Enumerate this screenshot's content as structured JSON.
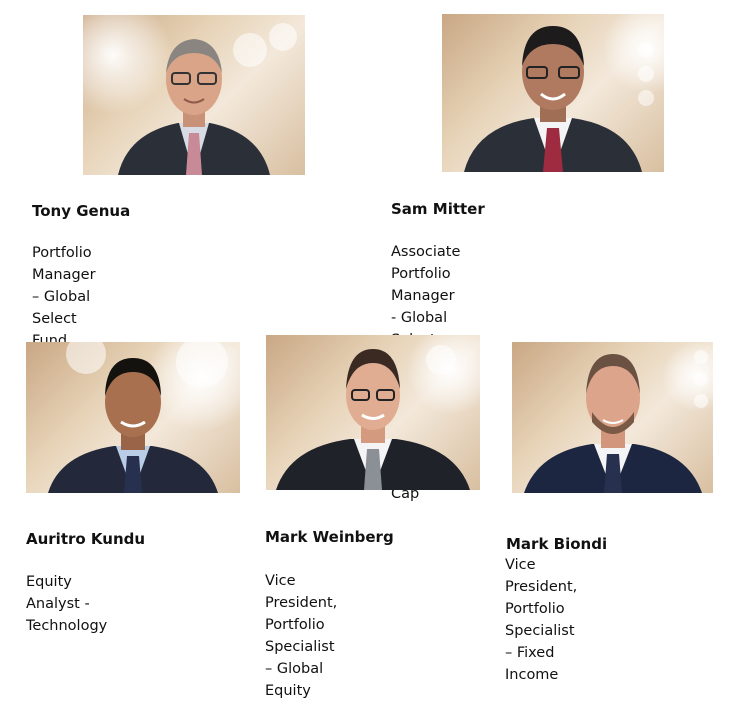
{
  "people": [
    {
      "name": "Tony Genua",
      "role": "Portfolio Manager – Global Select Fund,\nAmerican Growth & U.S. Small Mid Cap"
    },
    {
      "name": "Sam Mitter",
      "role": "Associate Portfolio Manager - Global Select\nFund, American Growth & U.S. Small Mid\nCap"
    },
    {
      "name": "Auritro Kundu",
      "role": "Equity Analyst - Technology"
    },
    {
      "name": "Mark Weinberg",
      "role": "Vice President, Portfolio\nSpecialist – Global Equity"
    },
    {
      "name": "Mark Biondi",
      "role": "Vice President, Portfolio\nSpecialist – Fixed Income"
    }
  ],
  "colors": {
    "suit": "#2b2f38",
    "skin": "#d9a488",
    "shirt_white": "#f4f4f6",
    "shirt_blue": "#b9cde6",
    "tie_pink": "#c98a97",
    "tie_red": "#9e2b3f",
    "tie_navy": "#27314f",
    "tie_gray": "#8b8f96"
  }
}
